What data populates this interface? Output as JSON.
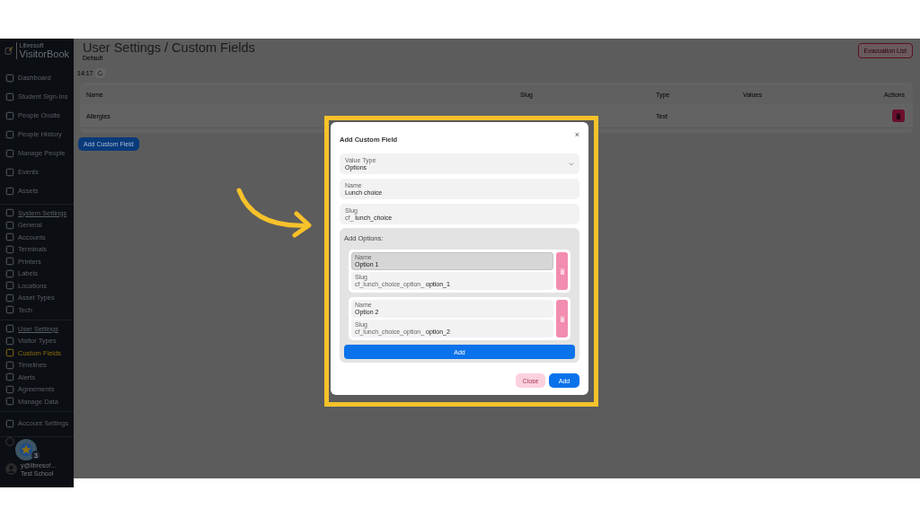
{
  "sidebar": {
    "brand_small": "Libresoft",
    "brand": "VisitorBook",
    "groups": [
      {
        "items": [
          {
            "kind": "link",
            "label": "Dashboard",
            "selected": false
          },
          {
            "kind": "link",
            "label": "Student Sign-Ins",
            "selected": false
          },
          {
            "kind": "link",
            "label": "People Onsite",
            "selected": false
          },
          {
            "kind": "link",
            "label": "People History",
            "selected": false
          },
          {
            "kind": "link",
            "label": "Manage People",
            "selected": false
          },
          {
            "kind": "link",
            "label": "Events",
            "selected": false
          },
          {
            "kind": "link",
            "label": "Assets",
            "selected": false
          }
        ]
      },
      {
        "items": [
          {
            "kind": "section",
            "label": "System Settings",
            "selected": false
          },
          {
            "kind": "sub",
            "label": "General",
            "selected": false
          },
          {
            "kind": "sub",
            "label": "Accounts",
            "selected": false
          },
          {
            "kind": "sub",
            "label": "Terminals",
            "selected": false
          },
          {
            "kind": "sub",
            "label": "Printers",
            "selected": false
          },
          {
            "kind": "sub",
            "label": "Labels",
            "selected": false
          },
          {
            "kind": "sub",
            "label": "Locations",
            "selected": false
          },
          {
            "kind": "sub",
            "label": "Asset Types",
            "selected": false
          },
          {
            "kind": "sub",
            "label": "Tech",
            "selected": false
          }
        ]
      },
      {
        "items": [
          {
            "kind": "section",
            "label": "User Settings",
            "selected": false
          },
          {
            "kind": "sub",
            "label": "Visitor Types",
            "selected": false
          },
          {
            "kind": "sub",
            "label": "Custom Fields",
            "selected": true
          },
          {
            "kind": "sub",
            "label": "Timelines",
            "selected": false
          },
          {
            "kind": "sub",
            "label": "Alerts",
            "selected": false
          },
          {
            "kind": "sub",
            "label": "Agreements",
            "selected": false
          },
          {
            "kind": "sub",
            "label": "Manage Data",
            "selected": false
          }
        ]
      },
      {
        "items": [
          {
            "kind": "link",
            "label": "Account Settings",
            "selected": false
          }
        ]
      }
    ],
    "notification_count": "3",
    "user_email": "y@libresof…",
    "user_school": "Test School"
  },
  "header": {
    "title": "User Settings / Custom Fields",
    "subtitle": "Default",
    "time": "14:17",
    "evacuation_button": "Evacuation List"
  },
  "table": {
    "columns": [
      "Name",
      "Slug",
      "Type",
      "Values",
      "Actions"
    ],
    "rows": [
      {
        "name": "Allergies",
        "type": "Text"
      }
    ]
  },
  "add_field_button": "Add Custom Field",
  "dialog": {
    "title": "Add Custom Field",
    "close_icon": "×",
    "value_type": {
      "label": "Value Type",
      "value": "Options"
    },
    "name": {
      "label": "Name",
      "value": "Lunch choice"
    },
    "slug": {
      "label": "Slug",
      "prefix": "cf_",
      "value": "lunch_choice"
    },
    "options_title": "Add Options:",
    "options": [
      {
        "name_label": "Name",
        "name": "Option 1",
        "focused": true,
        "slug_label": "Slug",
        "slug_prefix": "cf_lunch_choice_option_",
        "slug": "option_1"
      },
      {
        "name_label": "Name",
        "name": "Option 2",
        "focused": false,
        "slug_label": "Slug",
        "slug_prefix": "cf_lunch_choice_option_",
        "slug": "option_2"
      }
    ],
    "add_option_button": "Add",
    "close_button": "Close",
    "add_button": "Add"
  }
}
